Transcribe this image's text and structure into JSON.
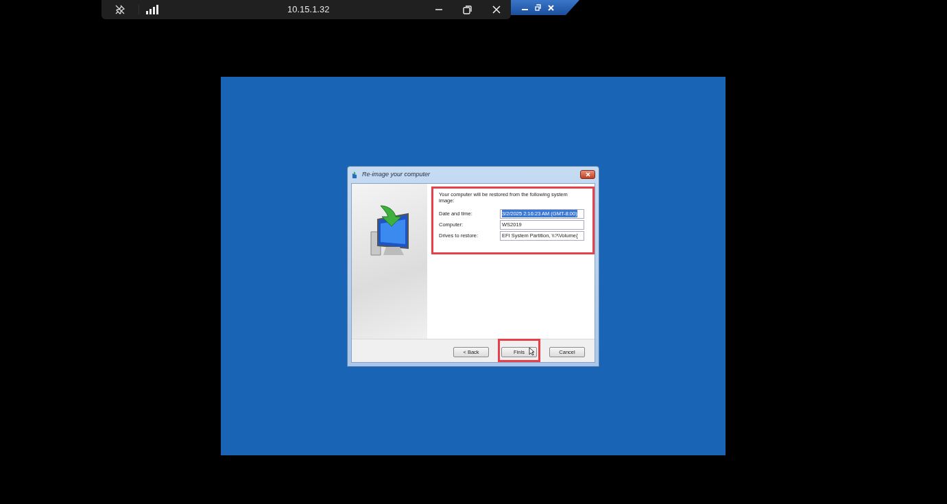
{
  "remote_bar": {
    "title": "10.15.1.32"
  },
  "dialog": {
    "title": "Re-image your computer",
    "intro": "Your computer will be restored from the following system image:",
    "fields": [
      {
        "label": "Date and time:",
        "value": "3/2/2025 2:16:23 AM (GMT-8:00)",
        "selected": true
      },
      {
        "label": "Computer:",
        "value": "WS2019",
        "selected": false
      },
      {
        "label": "Drives to restore:",
        "value": "EFI System Partition, \\\\?\\Volume{",
        "selected": false
      }
    ],
    "buttons": [
      {
        "label": "< Back",
        "highlighted": false
      },
      {
        "label": "Finis",
        "highlighted": true
      },
      {
        "label": "Cancel",
        "highlighted": false
      }
    ]
  }
}
